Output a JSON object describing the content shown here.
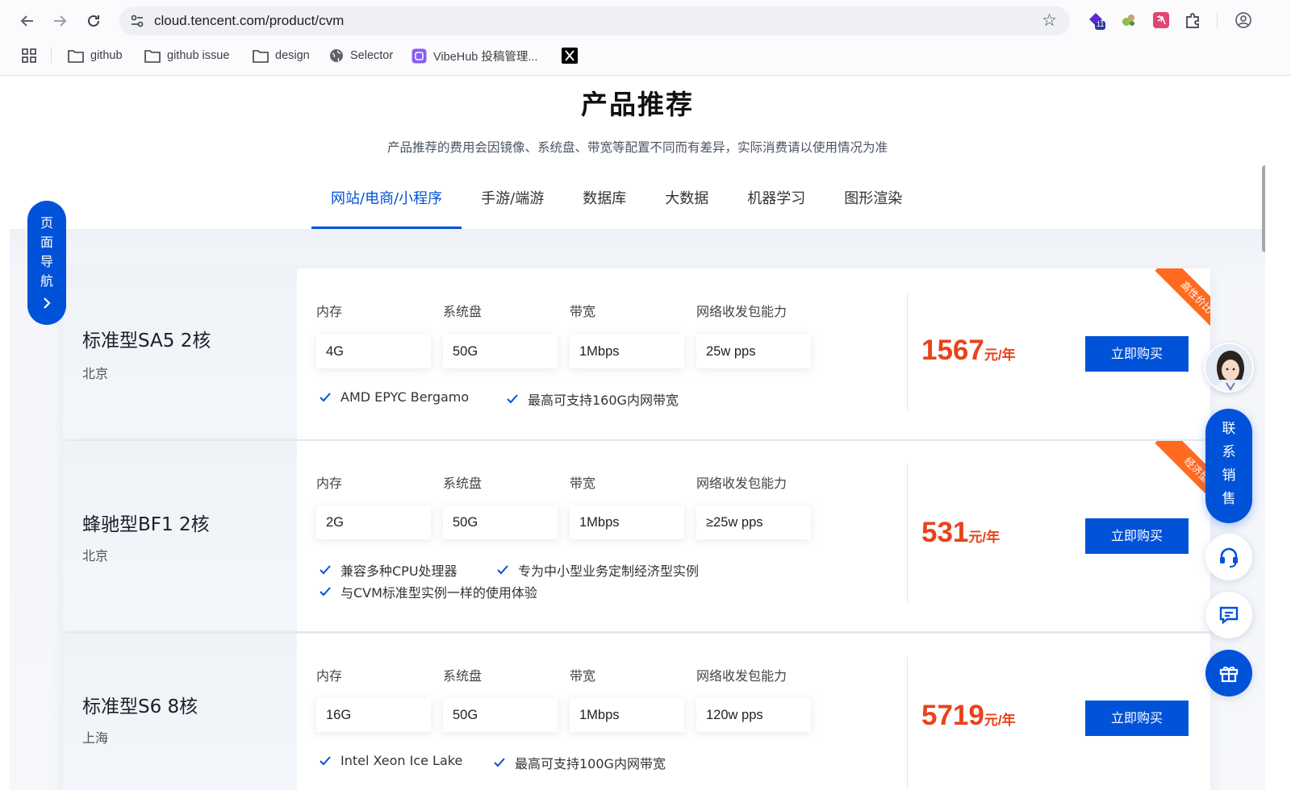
{
  "browser": {
    "url": "cloud.tencent.com/product/cvm",
    "extension_badge": "11",
    "bookmarks": [
      {
        "label": "github",
        "icon": "folder-icon"
      },
      {
        "label": "github issue",
        "icon": "folder-icon"
      },
      {
        "label": "design",
        "icon": "folder-icon"
      },
      {
        "label": "Selector",
        "icon": "globe-icon"
      },
      {
        "label": "VibeHub 投稿管理...",
        "icon": "vibehub-icon"
      },
      {
        "label": "",
        "icon": "x-logo-icon"
      }
    ]
  },
  "page": {
    "title": "产品推荐",
    "subtitle": "产品推荐的费用会因镜像、系统盘、带宽等配置不同而有差异，实际消费请以使用情况为准",
    "tabs": [
      {
        "label": "网站/电商/小程序",
        "active": true
      },
      {
        "label": "手游/端游",
        "active": false
      },
      {
        "label": "数据库",
        "active": false
      },
      {
        "label": "大数据",
        "active": false
      },
      {
        "label": "机器学习",
        "active": false
      },
      {
        "label": "图形渲染",
        "active": false
      }
    ],
    "spec_labels": {
      "memory": "内存",
      "disk": "系统盘",
      "bandwidth": "带宽",
      "pps": "网络收发包能力"
    },
    "buy_label": "立即购买",
    "price_unit": "元/年",
    "products": [
      {
        "name": "标准型SA5 2核",
        "region": "北京",
        "memory": "4G",
        "disk": "50G",
        "bandwidth": "1Mbps",
        "pps": "25w pps",
        "features": [
          "AMD EPYC Bergamo",
          "最高可支持160G内网带宽"
        ],
        "price": "1567",
        "ribbon": "高性价比"
      },
      {
        "name": "蜂驰型BF1 2核",
        "region": "北京",
        "memory": "2G",
        "disk": "50G",
        "bandwidth": "1Mbps",
        "pps": "≥25w pps",
        "features": [
          "兼容多种CPU处理器",
          "专为中小型业务定制经济型实例",
          "与CVM标准型实例一样的使用体验"
        ],
        "price": "531",
        "ribbon": "经济型"
      },
      {
        "name": "标准型S6 8核",
        "region": "上海",
        "memory": "16G",
        "disk": "50G",
        "bandwidth": "1Mbps",
        "pps": "120w pps",
        "features": [
          "Intel Xeon Ice Lake",
          "最高可支持100G内网带宽"
        ],
        "price": "5719",
        "ribbon": ""
      }
    ]
  },
  "side_nav": {
    "label_chars": [
      "页",
      "面",
      "导",
      "航"
    ]
  },
  "float_widgets": {
    "contact_sales_chars": [
      "联",
      "系",
      "销",
      "售"
    ],
    "icons": [
      "headset-icon",
      "message-icon",
      "gift-icon"
    ]
  },
  "colors": {
    "brand_blue": "#0052d9",
    "price_orange": "#e8431b",
    "ribbon_orange": "#ff6a1f"
  }
}
